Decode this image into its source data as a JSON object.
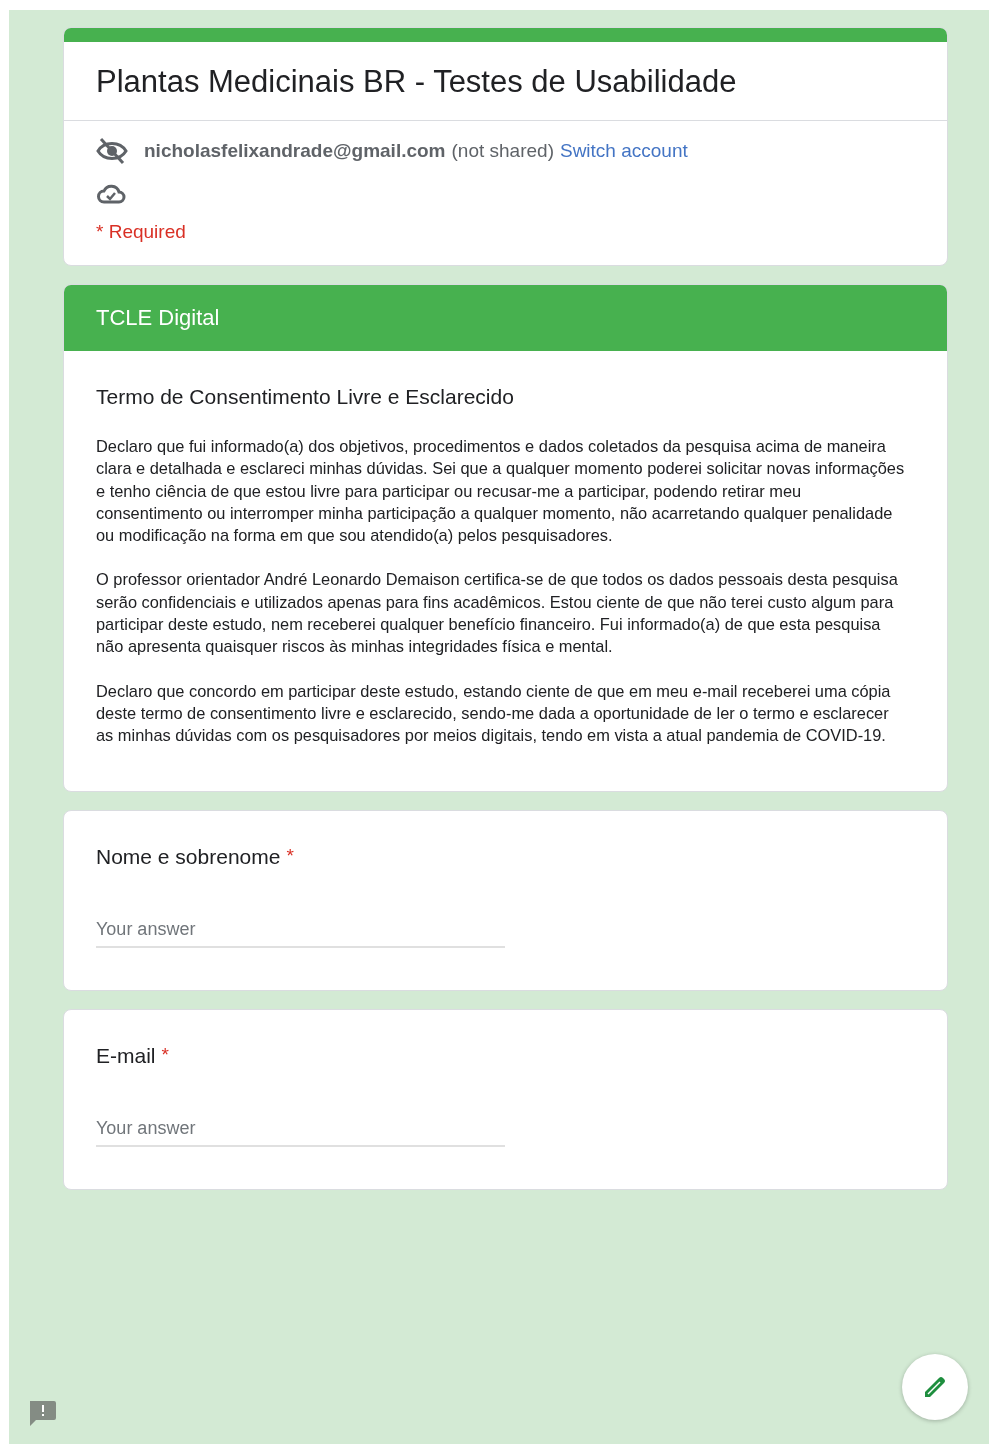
{
  "form": {
    "title": "Plantas Medicinais BR - Testes de Usabilidade"
  },
  "account": {
    "email": "nicholasfelixandrade@gmail.com",
    "note": "(not shared)",
    "switch_link": "Switch account"
  },
  "required_notice": "* Required",
  "section": {
    "header": "TCLE Digital",
    "title": "Termo de Consentimento Livre e Esclarecido",
    "paragraphs": [
      "Declaro que fui informado(a) dos objetivos, procedimentos e dados coletados da pesquisa acima de maneira clara e detalhada e esclareci minhas dúvidas. Sei que a qualquer momento poderei solicitar novas informações e tenho ciência de que estou livre para participar ou recusar-me a participar, podendo retirar meu consentimento ou interromper minha participação a qualquer momento, não acarretando qualquer penalidade ou modificação na forma em que sou atendido(a) pelos pesquisadores.",
      "O professor orientador André Leonardo Demaison certifica-se de que todos os dados pessoais desta pesquisa serão confidenciais e utilizados apenas para fins acadêmicos. Estou ciente de que não terei custo algum para participar deste estudo, nem receberei qualquer benefício financeiro. Fui informado(a) de que esta pesquisa não apresenta quaisquer riscos às minhas integridades física e mental.",
      "Declaro que concordo em participar deste estudo, estando ciente de que em meu e-mail receberei uma cópia deste termo de consentimento livre e esclarecido, sendo-me dada a oportunidade de ler o termo e esclarecer as minhas dúvidas com os pesquisadores por meios digitais, tendo em vista a atual pandemia de COVID-19."
    ]
  },
  "questions": [
    {
      "label": "Nome e sobrenome",
      "required_mark": "*",
      "placeholder": "Your answer"
    },
    {
      "label": "E-mail",
      "required_mark": "*",
      "placeholder": "Your answer"
    }
  ]
}
